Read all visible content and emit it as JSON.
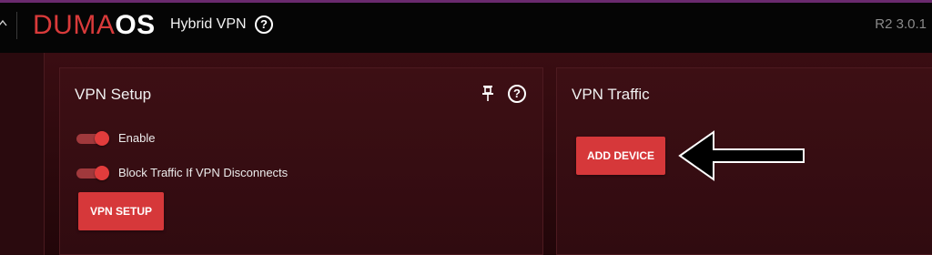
{
  "header": {
    "logo_part1": "DUMA",
    "logo_part2": "OS",
    "app_title": "Hybrid VPN",
    "help_symbol": "?",
    "version": "R2 3.0.1"
  },
  "setup_panel": {
    "title": "VPN Setup",
    "help_symbol": "?",
    "toggles": [
      {
        "label": "Enable",
        "on": true
      },
      {
        "label": "Block Traffic If VPN Disconnects",
        "on": true
      }
    ],
    "button_label": "VPN SETUP"
  },
  "traffic_panel": {
    "title": "VPN Traffic",
    "button_label": "ADD DEVICE"
  },
  "colors": {
    "accent_red": "#d6383a",
    "logo_red": "#d93a3a",
    "top_border": "#6a2a6e"
  },
  "icons": [
    "chevron-up-icon",
    "help-icon",
    "pin-icon",
    "arrow-left-icon"
  ]
}
